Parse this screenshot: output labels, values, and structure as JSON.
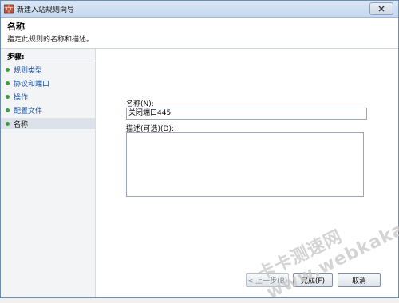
{
  "window": {
    "title": "新建入站规则向导"
  },
  "header": {
    "title": "名称",
    "subtitle": "指定此规则的名称和描述。"
  },
  "sidebar": {
    "label": "步骤:",
    "items": [
      {
        "label": "规则类型"
      },
      {
        "label": "协议和端口"
      },
      {
        "label": "操作"
      },
      {
        "label": "配置文件"
      },
      {
        "label": "名称"
      }
    ]
  },
  "form": {
    "name_label": "名称(N):",
    "name_value": "关闭端口445",
    "desc_label": "描述(可选)(D):",
    "desc_value": ""
  },
  "buttons": {
    "back": "< 上一步(B)",
    "finish": "完成(F)",
    "cancel": "取消"
  },
  "watermark": {
    "text": "卡卡测速网 www.webkaka.com"
  },
  "colors": {
    "accent": "#1a53a8",
    "step_dot": "#3aa03a",
    "selected_bg": "#dde2ea"
  },
  "icons": {
    "app": "firewall-icon",
    "close": "close-icon"
  }
}
